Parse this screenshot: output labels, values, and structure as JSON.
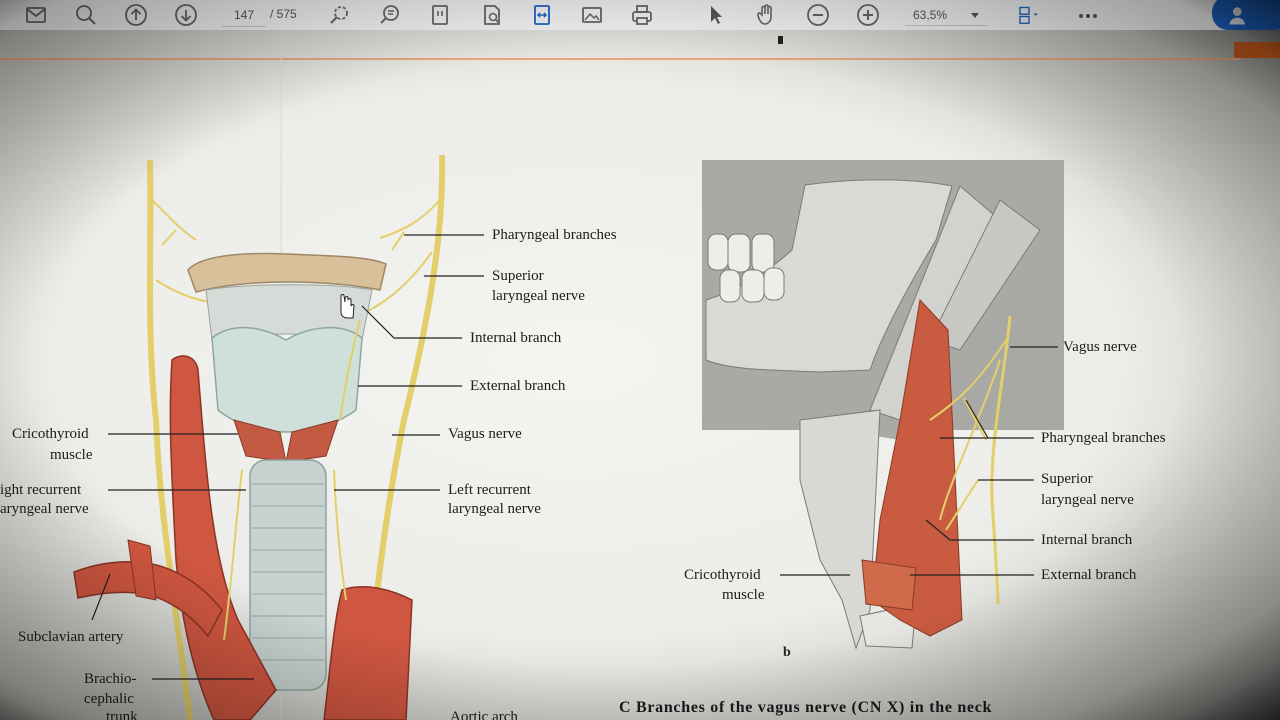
{
  "toolbar": {
    "current_page": "147",
    "page_total": "/ 575",
    "zoom": "63,5%"
  },
  "figure": {
    "left_labels": {
      "pharyngeal_branches": "Pharyngeal branches",
      "superior_laryngeal_nerve_1": "Superior",
      "superior_laryngeal_nerve_2": "laryngeal nerve",
      "internal_branch": "Internal branch",
      "external_branch": "External branch",
      "vagus_nerve": "Vagus nerve",
      "cricothyroid_1": "Cricothyroid",
      "cricothyroid_2": "muscle",
      "right_recurrent_1": "ight recurrent",
      "right_recurrent_2": "aryngeal nerve",
      "left_recurrent_1": "Left recurrent",
      "left_recurrent_2": "laryngeal nerve",
      "subclavian_artery": "Subclavian artery",
      "brachio_1": "Brachio-",
      "brachio_2": "cephalic",
      "brachio_3": "trunk",
      "aortic_arch": "Aortic arch"
    },
    "right_labels": {
      "vagus_nerve": "Vagus nerve",
      "pharyngeal_branches": "Pharyngeal branches",
      "superior_laryngeal_nerve_1": "Superior",
      "superior_laryngeal_nerve_2": "laryngeal nerve",
      "internal_branch": "Internal branch",
      "external_branch": "External branch",
      "cricothyroid_1": "Cricothyroid",
      "cricothyroid_2": "muscle"
    },
    "panel_b_letter": "b",
    "caption": "C  Branches of the vagus nerve (CN X) in the neck"
  }
}
